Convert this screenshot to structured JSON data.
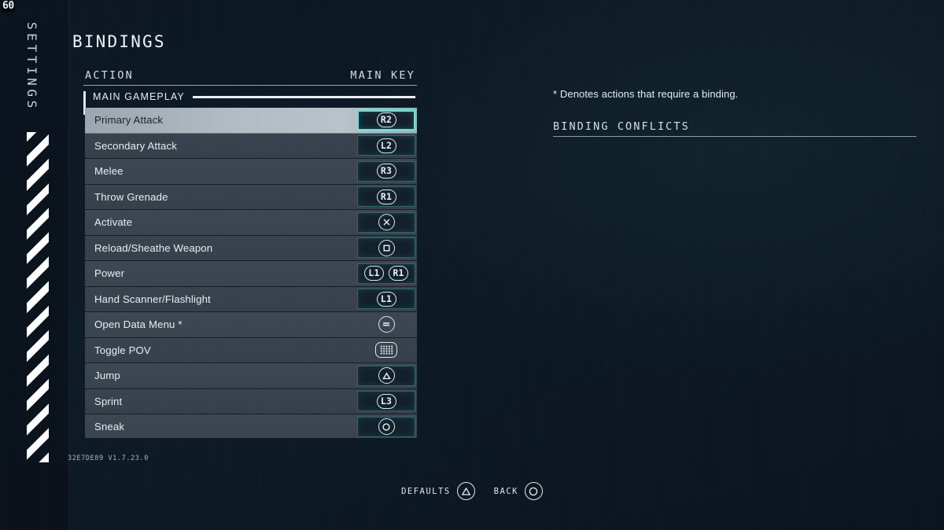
{
  "hud": {
    "fps": "60"
  },
  "rail": {
    "title": "SETTINGS",
    "stripes_icon": "diagonal-stripes"
  },
  "header": {
    "page_title": "BINDINGS"
  },
  "columns": {
    "action": "ACTION",
    "main_key": "MAIN KEY"
  },
  "category": {
    "label": "MAIN GAMEPLAY"
  },
  "bindings": [
    {
      "action": "Primary Attack",
      "selected": true,
      "keys": [
        {
          "glyph": "R2",
          "shape": "pill"
        }
      ]
    },
    {
      "action": "Secondary Attack",
      "selected": false,
      "keys": [
        {
          "glyph": "L2",
          "shape": "pill"
        }
      ]
    },
    {
      "action": "Melee",
      "selected": false,
      "keys": [
        {
          "glyph": "R3",
          "shape": "pill"
        }
      ]
    },
    {
      "action": "Throw Grenade",
      "selected": false,
      "keys": [
        {
          "glyph": "R1",
          "shape": "pill"
        }
      ]
    },
    {
      "action": "Activate",
      "selected": false,
      "keys": [
        {
          "glyph": "cross-button",
          "shape": "round"
        }
      ]
    },
    {
      "action": "Reload/Sheathe Weapon",
      "selected": false,
      "keys": [
        {
          "glyph": "square-button",
          "shape": "round"
        }
      ]
    },
    {
      "action": "Power",
      "selected": false,
      "keys": [
        {
          "glyph": "L1",
          "shape": "pill"
        },
        {
          "glyph": "R1",
          "shape": "pill"
        }
      ]
    },
    {
      "action": "Hand Scanner/Flashlight",
      "selected": false,
      "keys": [
        {
          "glyph": "L1",
          "shape": "pill"
        }
      ]
    },
    {
      "action": "Open Data Menu *",
      "selected": false,
      "keys": [
        {
          "glyph": "options-button",
          "shape": "round"
        }
      ],
      "no_slot": true
    },
    {
      "action": "Toggle POV",
      "selected": false,
      "keys": [
        {
          "glyph": "touchpad-button",
          "shape": "touchpad"
        }
      ],
      "no_slot": true
    },
    {
      "action": "Jump",
      "selected": false,
      "keys": [
        {
          "glyph": "triangle-button",
          "shape": "round"
        }
      ]
    },
    {
      "action": "Sprint",
      "selected": false,
      "keys": [
        {
          "glyph": "L3",
          "shape": "pill"
        }
      ]
    },
    {
      "action": "Sneak",
      "selected": false,
      "keys": [
        {
          "glyph": "circle-button",
          "shape": "round"
        }
      ]
    }
  ],
  "version": {
    "build": "32E7DE89 V1.7.23.0"
  },
  "info": {
    "denotes": "* Denotes actions that require a binding.",
    "conflicts_title": "BINDING CONFLICTS"
  },
  "footer": {
    "defaults_label": "DEFAULTS",
    "defaults_key": "triangle-button",
    "back_label": "BACK",
    "back_key": "circle-button"
  },
  "colors": {
    "background": "#0d1a26",
    "row": "#3a444f",
    "row_selected": "#b2bcc4",
    "accent_teal": "#6fe0d9",
    "text_primary": "#e9eef3",
    "key_slot_bg": "#12202b"
  }
}
